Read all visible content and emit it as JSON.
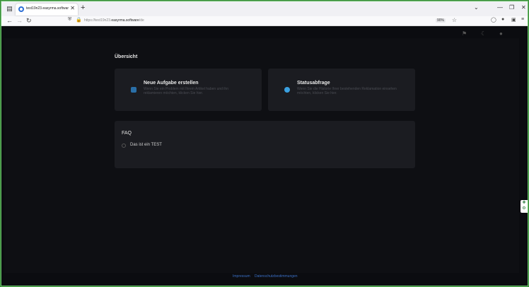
{
  "browser": {
    "tab_title": "test19n23.easyrma.software/de",
    "new_tab": "+",
    "url_prefix": "https://test19n23.",
    "url_domain": "easyrma.software",
    "url_suffix": "/de",
    "zoom": "90%"
  },
  "icons": {
    "tab_list": "clipboard-icon",
    "back": "arrow-left-icon",
    "forward": "arrow-right-icon",
    "reload": "reload-icon",
    "shield": "shield-icon",
    "lock": "lock-icon",
    "star": "star-icon",
    "flag": "flag-icon",
    "moon": "moon-icon",
    "user": "user-icon"
  },
  "page": {
    "title": "Übersicht",
    "cards": [
      {
        "title": "Neue Aufgabe erstellen",
        "description": "Wenn Sie ein Problem mit Ihrem Artikel haben und ihn reklamieren möchten, klicken Sie hier.",
        "accent": "#2a6fa8"
      },
      {
        "title": "Statusabfrage",
        "description": "Wenn Sie die Historie Ihrer bestehenden Reklamation einsehen möchten, klicken Sie hier.",
        "accent": "#3aa0e0"
      }
    ],
    "faq": {
      "title": "FAQ",
      "items": [
        "Das ist ein TEST"
      ]
    },
    "footer": {
      "links": [
        "Impressum",
        "Datenschutzbestimmungen"
      ]
    }
  }
}
